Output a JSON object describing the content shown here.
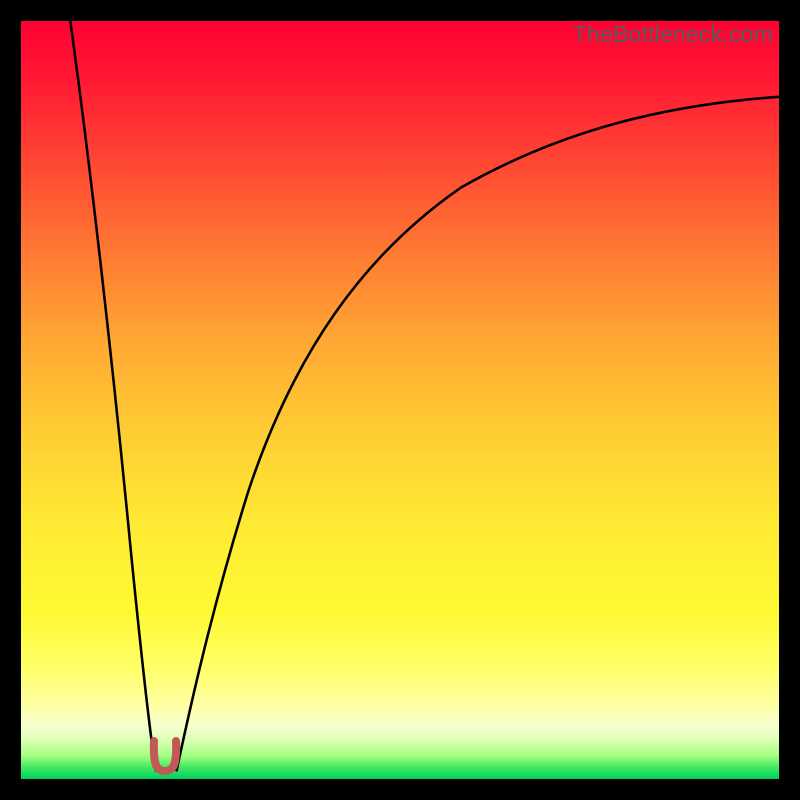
{
  "watermark": "TheBottleneck.com",
  "chart_data": {
    "type": "line",
    "title": "",
    "xlabel": "",
    "ylabel": "",
    "xlim": [
      0,
      100
    ],
    "ylim": [
      0,
      100
    ],
    "grid": false,
    "legend": false,
    "series": [
      {
        "name": "bottleneck-curve-left",
        "x": [
          6.5,
          8,
          10,
          12,
          14,
          15.5,
          16.5,
          17.2,
          17.8
        ],
        "values": [
          100,
          86,
          68,
          48,
          28,
          13,
          6,
          2.5,
          1
        ]
      },
      {
        "name": "bottleneck-curve-right",
        "x": [
          20.5,
          22,
          24,
          27,
          31,
          36,
          42,
          50,
          60,
          72,
          86,
          100
        ],
        "values": [
          1,
          4,
          12,
          25,
          40,
          53,
          64,
          73,
          79.5,
          84,
          87.5,
          90
        ]
      }
    ],
    "annotations": [
      {
        "name": "optimal-marker",
        "x": 19,
        "y": 1,
        "shape": "u",
        "color": "#c15a56"
      }
    ],
    "background_gradient": {
      "top": "#ff0033",
      "mid": "#ffe933",
      "bottom": "#00d060"
    }
  }
}
